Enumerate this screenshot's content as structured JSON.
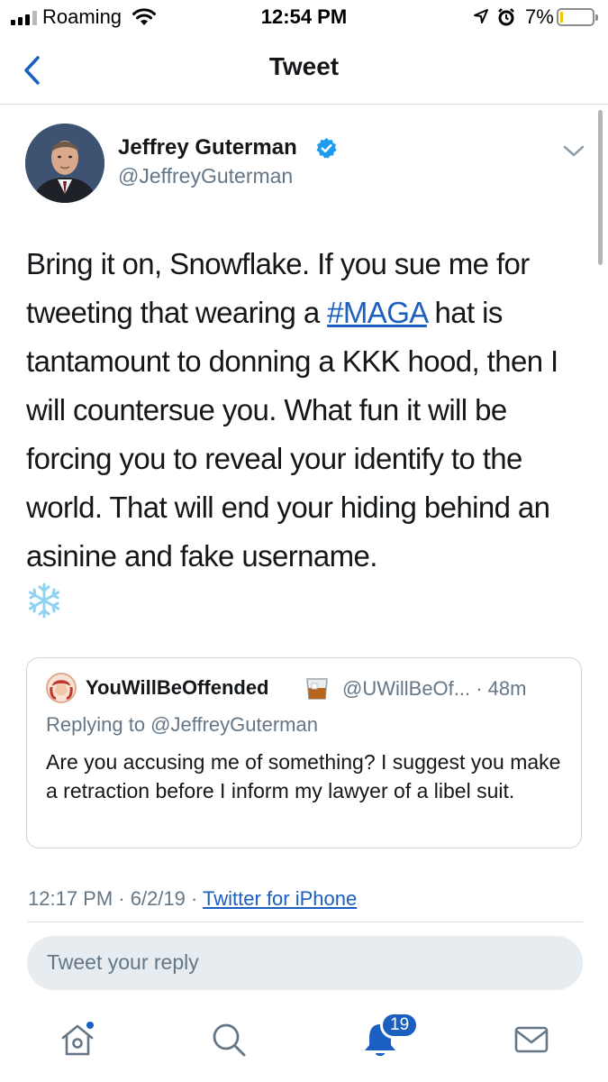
{
  "status_bar": {
    "carrier": "Roaming",
    "time": "12:54 PM",
    "battery_percent": "7%",
    "battery_level": 0.07,
    "signal_bars": 4,
    "signal_bars_active": 3
  },
  "nav": {
    "title": "Tweet",
    "back_icon": "chevron-left-icon"
  },
  "tweet": {
    "author_name": "Jeffrey Guterman",
    "author_handle": "@JeffreyGuterman",
    "verified": true,
    "text_before_hashtag": "Bring it on, Snowflake. If you sue me for tweeting that wearing a ",
    "hashtag": "#MAGA",
    "text_after_hashtag": " hat is tantamount to donning a KKK hood, then I will countersue you. What fun it will be forcing you to reveal your identify to the world. That will end your hiding behind an asinine and fake username.",
    "emoji": "snowflake-icon",
    "timestamp": "12:17 PM · 6/2/19 · ",
    "source": "Twitter for iPhone"
  },
  "quoted_tweet": {
    "author_name": "YouWillBeOffended",
    "author_handle_and_time": "@UWillBeOf... · 48m",
    "replying_to": "Replying to @JeffreyGuterman",
    "text": "Are you accusing me of something?  I suggest you make a retraction before I inform my lawyer of a libel suit."
  },
  "reply_box": {
    "placeholder": "Tweet your reply"
  },
  "tab_bar": {
    "items": [
      "home-icon",
      "search-icon",
      "bell-icon",
      "mail-icon"
    ],
    "notifications_count": "19"
  },
  "colors": {
    "link": "#1b5fc1",
    "secondary_text": "#657786",
    "reply_box_bg": "#e6ecf0",
    "battery_low": "#f5c400"
  }
}
